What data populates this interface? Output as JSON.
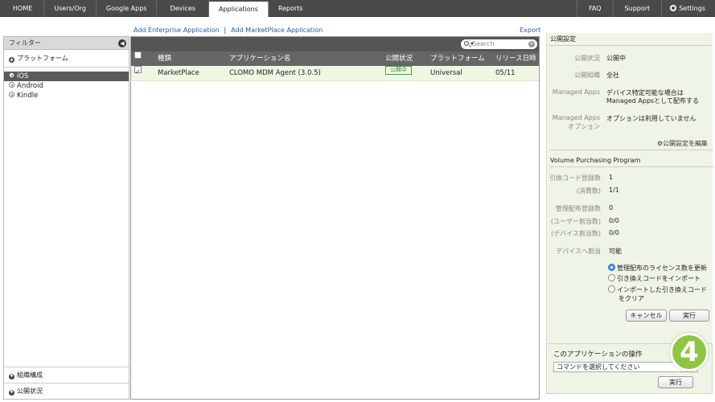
{
  "nav": {
    "left": [
      "HOME",
      "Users/Org",
      "Google Apps",
      "Devices",
      "Applications",
      "Reports"
    ],
    "active": "Applications",
    "right": {
      "faq": "FAQ",
      "support": "Support",
      "settings": "Settings"
    }
  },
  "filter": {
    "header": "フィルター",
    "section_platform": "プラットフォーム",
    "platforms": [
      "iOS",
      "Android",
      "Kindle"
    ],
    "selected_platform": "iOS",
    "section_org": "組織構成",
    "section_status": "公開状況"
  },
  "links": {
    "add_enterprise": "Add Enterprise Application",
    "separator": "|",
    "add_marketplace": "Add MarketPlace Application",
    "export": "Export"
  },
  "table": {
    "search_placeholder": "Search",
    "headers": [
      "種類",
      "アプリケーション名",
      "公開状況",
      "プラットフォーム",
      "リリース日時"
    ],
    "rows": [
      {
        "type": "MarketPlace",
        "name": "CLOMO MDM Agent (3.0.5)",
        "status": "公開中",
        "platform": "Universal",
        "release": "05/11",
        "checked": true
      }
    ]
  },
  "publish_settings": {
    "title": "公開設定",
    "status_label": "公開状況",
    "status_value": "公開中",
    "org_label": "公開組織",
    "org_value": "全社",
    "managed_label": "Managed Apps",
    "managed_value_1": "デバイス特定可能な場合は",
    "managed_value_2": "Managed Appsとして配布する",
    "managed_opt_label_1": "Managed Apps",
    "managed_opt_label_2": "オプション",
    "managed_opt_value": "オプションは利用していません",
    "edit_link": "公開設定を編集"
  },
  "vpp": {
    "title": "Volume Purchasing Program",
    "redeem_label": "引換コード登録数",
    "redeem_value": "1",
    "consumed_label": "(消費数)",
    "consumed_value": "1/1",
    "managed_dist_label": "管理配布登録数",
    "managed_dist_value": "0",
    "user_assign_label": "(ユーザー割当数)",
    "user_assign_value": "0/0",
    "device_assign_label": "(デバイス割当数)",
    "device_assign_value": "0/0",
    "device_alloc_label": "デバイスへ割当",
    "device_alloc_value": "可能",
    "options": [
      "管理配布のライセンス数を更新",
      "引き換えコードをインポート",
      "インポートした引き換えコード",
      "をクリア"
    ],
    "selected_option": 0,
    "cancel": "キャンセル",
    "execute": "実行"
  },
  "app_actions": {
    "title": "このアプリケーションの操作",
    "select_value": "コマンドを選択してください",
    "execute": "実行"
  },
  "step": "4"
}
